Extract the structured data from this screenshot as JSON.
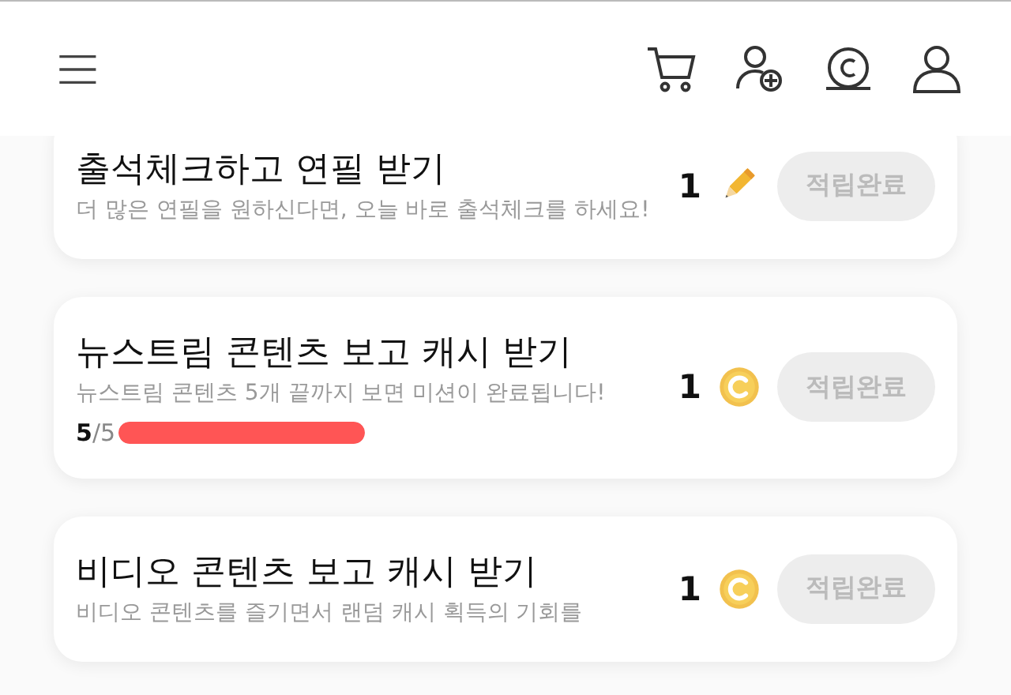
{
  "missions": [
    {
      "title": "출석체크하고 연필 받기",
      "description": "더 많은 연필을 원하신다면, 오늘 바로 출석체크를 하세요!",
      "reward": "1",
      "kind": "pencil",
      "button": "적립완료",
      "disabled": true
    },
    {
      "title": "뉴스트림 콘텐츠 보고 캐시 받기",
      "description": "뉴스트림 콘텐츠 5개 끝까지 보면 미션이 완료됩니다!",
      "progress": {
        "text": "**5**/5",
        "level": 1
      },
      "reward": "1",
      "kind": "coin",
      "button": "적립완료",
      "disabled": true
    },
    {
      "title": "비디오 콘텐츠 보고 캐시 받기",
      "description": "비디오 콘텐츠를 즐기면서 랜덤 캐시 획득의 기회를",
      "reward": "1",
      "kind": "coin",
      "button": "적립완료",
      "disabled": true
    }
  ]
}
